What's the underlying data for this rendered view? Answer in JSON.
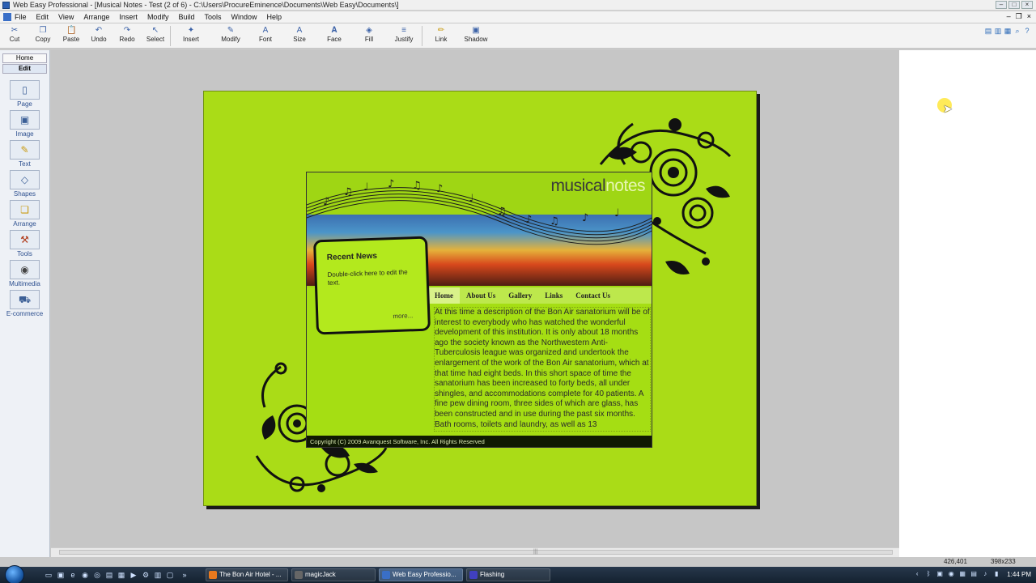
{
  "window": {
    "title": "Web Easy Professional - [Musical Notes - Test (2 of 6)  - C:\\Users\\ProcureEminence\\Documents\\Web Easy\\Documents\\]"
  },
  "menu": [
    "File",
    "Edit",
    "View",
    "Arrange",
    "Insert",
    "Modify",
    "Build",
    "Tools",
    "Window",
    "Help"
  ],
  "toolbar": {
    "buttons": [
      {
        "label": "Cut",
        "icon": "scissors-icon"
      },
      {
        "label": "Copy",
        "icon": "copy-icon"
      },
      {
        "label": "Paste",
        "icon": "paste-icon"
      },
      {
        "label": "Undo",
        "icon": "undo-icon"
      },
      {
        "label": "Redo",
        "icon": "redo-icon"
      },
      {
        "label": "Select",
        "icon": "pointer-icon"
      },
      {
        "label": "Insert",
        "icon": "insert-icon"
      },
      {
        "label": "Modify",
        "icon": "modify-icon"
      },
      {
        "label": "Font",
        "icon": "font-icon"
      },
      {
        "label": "Size",
        "icon": "size-icon"
      },
      {
        "label": "Face",
        "icon": "face-icon"
      },
      {
        "label": "Fill",
        "icon": "fill-icon"
      },
      {
        "label": "Justify",
        "icon": "justify-icon"
      },
      {
        "label": "Link",
        "icon": "link-icon"
      },
      {
        "label": "Shadow",
        "icon": "shadow-icon"
      }
    ]
  },
  "side_panel": {
    "tabs": [
      "Home",
      "Edit"
    ],
    "active_tab": "Edit",
    "items": [
      {
        "label": "Page",
        "icon": "page-icon"
      },
      {
        "label": "Image",
        "icon": "image-icon"
      },
      {
        "label": "Text",
        "icon": "text-icon"
      },
      {
        "label": "Shapes",
        "icon": "shapes-icon"
      },
      {
        "label": "Arrange",
        "icon": "arrange-icon"
      },
      {
        "label": "Tools",
        "icon": "tools-icon"
      },
      {
        "label": "Multimedia",
        "icon": "multimedia-icon"
      },
      {
        "label": "E-commerce",
        "icon": "cart-icon"
      }
    ]
  },
  "template": {
    "logo_part1": "musical",
    "logo_part2": "notes",
    "nav": [
      "Home",
      "About Us",
      "Gallery",
      "Links",
      "Contact Us"
    ],
    "nav_active": "Home",
    "news_title": "Recent News",
    "news_text": "Double-click here to edit the text.",
    "news_more": "more...",
    "body_text": "At this time a description of the Bon Air sanatorium will be of interest to everybody who has watched the wonderful development of this institution. It is only about 18 months ago the society known as the Northwestern Anti-Tuberculosis league was organized and undertook the enlargement of the work of the Bon Air sanatorium, which at that time had eight beds. In this short space of time the sanatorium has been increased to forty beds, all under shingles, and accommodations complete for 40 patients. A fine pew dining room, three sides of which are glass, has been constructed and in use during the past six months. Bath rooms, toilets and laundry, as well as 13",
    "footer": "Copyright (C) 2009 Avanquest Software, Inc. All Rights Reserved",
    "colors": {
      "page_bg": "#aadc17",
      "footer_bg": "#0f1a02"
    }
  },
  "status": {
    "coords": "426,401",
    "size": "398x233"
  },
  "taskbar": {
    "tasks": [
      {
        "label": "The Bon Air Hotel - ...",
        "active": false
      },
      {
        "label": "magicJack",
        "active": false
      },
      {
        "label": "Web Easy Professio...",
        "active": true
      },
      {
        "label": "Flashing",
        "active": false
      }
    ],
    "clock": "1:44 PM"
  }
}
